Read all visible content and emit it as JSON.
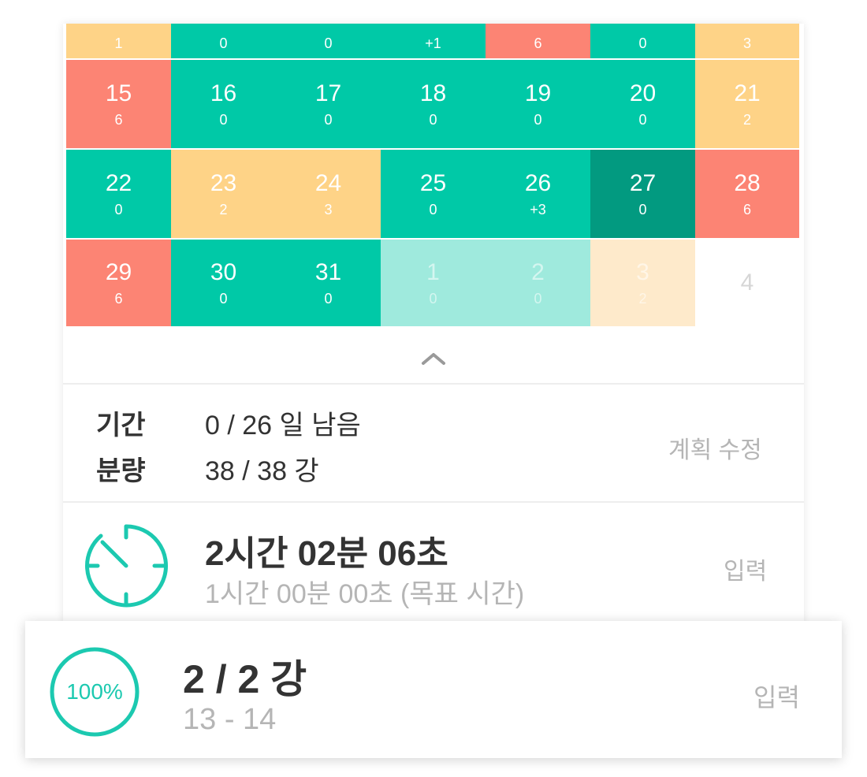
{
  "calendar": {
    "colors": {
      "red": "#fc8474",
      "green": "#00c9a7",
      "yellow": "#fed387",
      "dark_green": "#029a80",
      "light_green": "#9feadd",
      "light_yellow": "#feeacb"
    },
    "rows": [
      [
        {
          "day": "",
          "count": "1",
          "color": "yellow"
        },
        {
          "day": "",
          "count": "0",
          "color": "green"
        },
        {
          "day": "",
          "count": "0",
          "color": "green"
        },
        {
          "day": "",
          "count": "+1",
          "color": "green"
        },
        {
          "day": "",
          "count": "6",
          "color": "red"
        },
        {
          "day": "",
          "count": "0",
          "color": "green"
        },
        {
          "day": "",
          "count": "3",
          "color": "yellow"
        }
      ],
      [
        {
          "day": "15",
          "count": "6",
          "color": "red"
        },
        {
          "day": "16",
          "count": "0",
          "color": "green"
        },
        {
          "day": "17",
          "count": "0",
          "color": "green"
        },
        {
          "day": "18",
          "count": "0",
          "color": "green"
        },
        {
          "day": "19",
          "count": "0",
          "color": "green"
        },
        {
          "day": "20",
          "count": "0",
          "color": "green"
        },
        {
          "day": "21",
          "count": "2",
          "color": "yellow"
        }
      ],
      [
        {
          "day": "22",
          "count": "0",
          "color": "green"
        },
        {
          "day": "23",
          "count": "2",
          "color": "yellow"
        },
        {
          "day": "24",
          "count": "3",
          "color": "yellow"
        },
        {
          "day": "25",
          "count": "0",
          "color": "green"
        },
        {
          "day": "26",
          "count": "+3",
          "color": "green"
        },
        {
          "day": "27",
          "count": "0",
          "color": "dark_green"
        },
        {
          "day": "28",
          "count": "6",
          "color": "red"
        }
      ],
      [
        {
          "day": "29",
          "count": "6",
          "color": "red"
        },
        {
          "day": "30",
          "count": "0",
          "color": "green"
        },
        {
          "day": "31",
          "count": "0",
          "color": "green"
        },
        {
          "day": "1",
          "count": "0",
          "color": "light_green"
        },
        {
          "day": "2",
          "count": "0",
          "color": "light_green"
        },
        {
          "day": "3",
          "count": "2",
          "color": "light_yellow"
        },
        {
          "day": "4",
          "count": "",
          "color": "none"
        }
      ]
    ]
  },
  "collapse_icon": "chevron-up-icon",
  "plan": {
    "period_label": "기간",
    "period_value": "0 / 26 일 남음",
    "amount_label": "분량",
    "amount_value": "38 / 38 강",
    "edit_label": "계획 수정"
  },
  "timer": {
    "icon": "timer-icon",
    "elapsed": "2시간 02분 06초",
    "goal": "1시간 00분 00초 (목표 시간)",
    "input_label": "입력"
  },
  "progress": {
    "percent_label": "100%",
    "percent": 100,
    "lectures": "2 / 2 강",
    "range": "13 - 14",
    "input_label": "입력"
  }
}
